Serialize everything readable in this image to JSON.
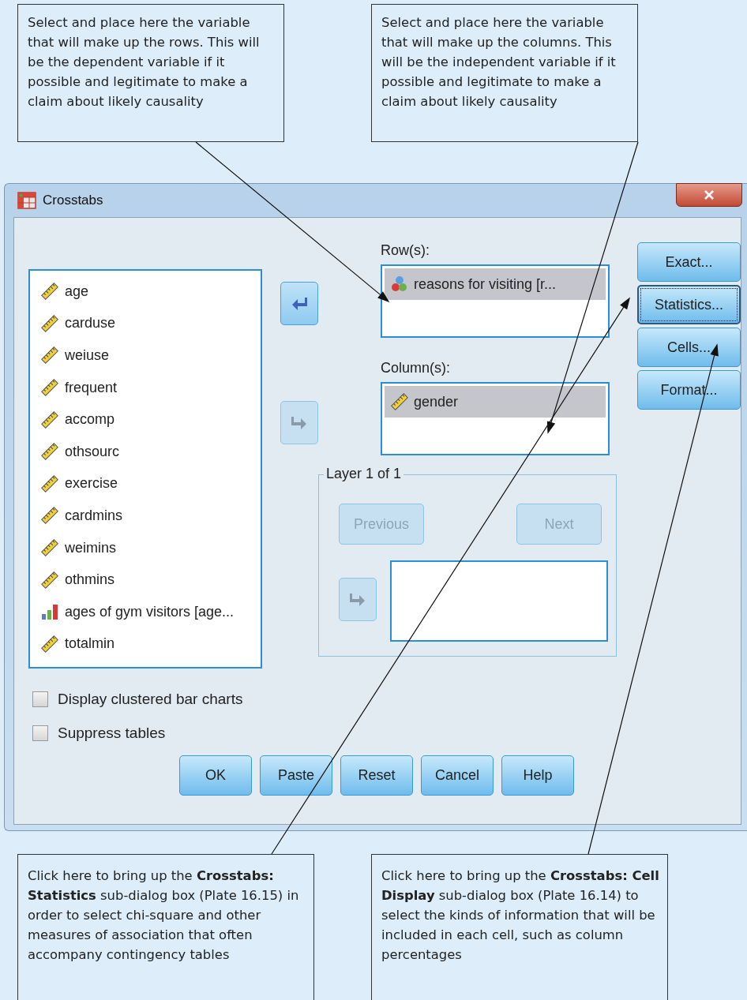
{
  "callouts_top": [
    {
      "text": "Select and place here the variable that will make up the rows. This will be the dependent variable if it possible and legitimate to make a claim about likely causality"
    },
    {
      "text": "Select and place here the variable that will make up the columns. This will be the independent variable if it possible and legitimate to make a claim about likely causality"
    }
  ],
  "window": {
    "title": "Crosstabs"
  },
  "variables": [
    {
      "name": "age",
      "kind": "scale"
    },
    {
      "name": "carduse",
      "kind": "scale"
    },
    {
      "name": "weiuse",
      "kind": "scale"
    },
    {
      "name": "frequent",
      "kind": "scale"
    },
    {
      "name": "accomp",
      "kind": "scale"
    },
    {
      "name": "othsourc",
      "kind": "scale"
    },
    {
      "name": "exercise",
      "kind": "scale"
    },
    {
      "name": "cardmins",
      "kind": "scale"
    },
    {
      "name": "weimins",
      "kind": "scale"
    },
    {
      "name": "othmins",
      "kind": "scale"
    },
    {
      "name": "ages of gym visitors [age...",
      "kind": "ordinal"
    },
    {
      "name": "totalmin",
      "kind": "scale"
    }
  ],
  "row": {
    "label": "Row(s):",
    "arrow_disabled": false,
    "items": [
      {
        "name": "reasons for visiting [r...",
        "kind": "nominal",
        "selected": true
      }
    ]
  },
  "column": {
    "label": "Column(s):",
    "arrow_disabled": true,
    "items": [
      {
        "name": "gender",
        "kind": "scale",
        "selected": true
      }
    ]
  },
  "layer": {
    "title": "Layer 1 of 1",
    "previous": {
      "label": "Previous",
      "disabled": true
    },
    "next": {
      "label": "Next",
      "disabled": true
    },
    "arrow_disabled": true
  },
  "side_buttons": [
    {
      "label": "Exact...",
      "focused": false
    },
    {
      "label": "Statistics...",
      "focused": true
    },
    {
      "label": "Cells...",
      "focused": false
    },
    {
      "label": "Format...",
      "focused": false
    }
  ],
  "checkboxes": [
    {
      "label": "Display clustered bar charts",
      "checked": false
    },
    {
      "label": "Suppress tables",
      "checked": false
    }
  ],
  "buttons": [
    "OK",
    "Paste",
    "Reset",
    "Cancel",
    "Help"
  ],
  "callouts_bottom": [
    {
      "text": "Click here to bring up the **Crosstabs: Statistics** sub-dialog box (Plate 16.15) in order to select chi-square and other measures of association that  often accompany contingency tables"
    },
    {
      "text": "Click here to bring up the **Crosstabs: Cell Display** sub-dialog box (Plate 16.14) to select the kinds of information that will be included in each cell, such as column percentages"
    }
  ]
}
